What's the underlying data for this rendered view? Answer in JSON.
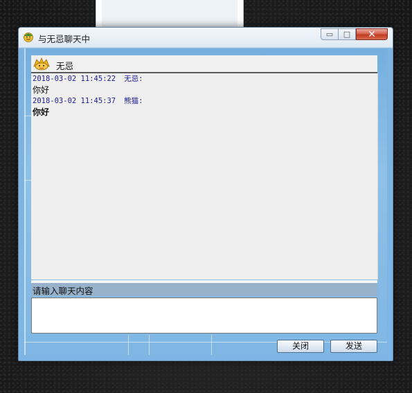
{
  "window": {
    "title": "与无忌聊天中",
    "controls": {
      "minimize": "▭",
      "maximize": "□",
      "close": "✕"
    }
  },
  "chat": {
    "friend_name": "无忌",
    "messages": [
      {
        "timestamp": "2018-03-02 11:45:22",
        "sender": "无忌:",
        "text": "你好",
        "bold": false
      },
      {
        "timestamp": "2018-03-02 11:45:37",
        "sender": "熊猫:",
        "text": "你好",
        "bold": true
      }
    ]
  },
  "input": {
    "label": "请输入聊天内容",
    "value": ""
  },
  "buttons": {
    "close": "关闭",
    "send": "发送"
  },
  "icons": {
    "title": "smiley-avatar-icon",
    "friend": "cartoon-avatar-icon"
  },
  "colors": {
    "accent_blue": "#7db6e6",
    "meta_text": "#1c1c9a",
    "close_red": "#c23a22"
  }
}
